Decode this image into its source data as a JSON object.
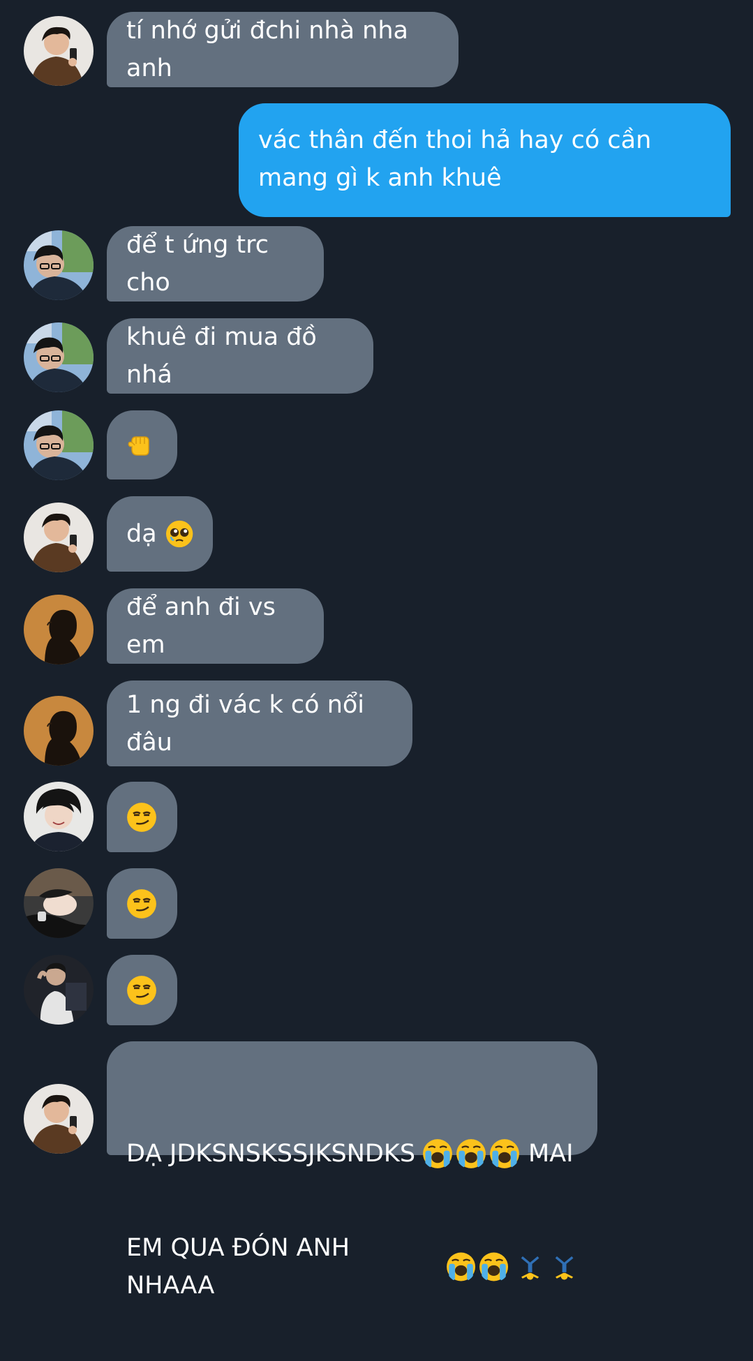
{
  "messages": [
    {
      "text": "tí nhớ gửi đchi nhà nha anh",
      "direction": "in",
      "avatar": "avatar-boy-phone"
    },
    {
      "text": "vác thân đến thoi hả hay có cần mang gì k anh khuê",
      "direction": "out"
    },
    {
      "text": "để t ứng trc cho",
      "direction": "in",
      "avatar": "avatar-boy-glasses"
    },
    {
      "text": "khuê đi mua đồ nhá",
      "direction": "in",
      "avatar": "avatar-boy-glasses"
    },
    {
      "text": "",
      "emoji": "pointing-fist-emoji",
      "direction": "in",
      "avatar": "avatar-boy-glasses"
    },
    {
      "text": "dạ",
      "emoji": "pleading-face-emoji",
      "direction": "in",
      "avatar": "avatar-boy-phone"
    },
    {
      "text": "để anh đi vs em",
      "direction": "in",
      "avatar": "avatar-silhouette-orange"
    },
    {
      "text": "1 ng đi vác k có nổi đâu",
      "direction": "in",
      "avatar": "avatar-silhouette-orange"
    },
    {
      "text": "",
      "emoji": "smirk-emoji",
      "direction": "in",
      "avatar": "avatar-boy-smiling"
    },
    {
      "text": "",
      "emoji": "smirk-emoji",
      "direction": "in",
      "avatar": "avatar-boy-lying"
    },
    {
      "text": "",
      "emoji": "smirk-emoji",
      "direction": "in",
      "avatar": "avatar-boy-dark"
    },
    {
      "text_line1": "DẠ JDKSNSKSSJKSNDKS",
      "text_line1_tail": "MAI",
      "text_line2": "EM QUA ĐÓN ANH NHAAA",
      "emojis": [
        "crying-emoji",
        "crying-emoji",
        "crying-emoji",
        "crying-emoji",
        "crying-emoji",
        "cartwheel-emoji",
        "cartwheel-emoji"
      ],
      "direction": "in",
      "avatar": "avatar-boy-phone"
    }
  ],
  "colors": {
    "background": "#18202b",
    "incoming_bubble": "#63707f",
    "outgoing_bubble": "#22a3f0",
    "text": "#ffffff"
  }
}
